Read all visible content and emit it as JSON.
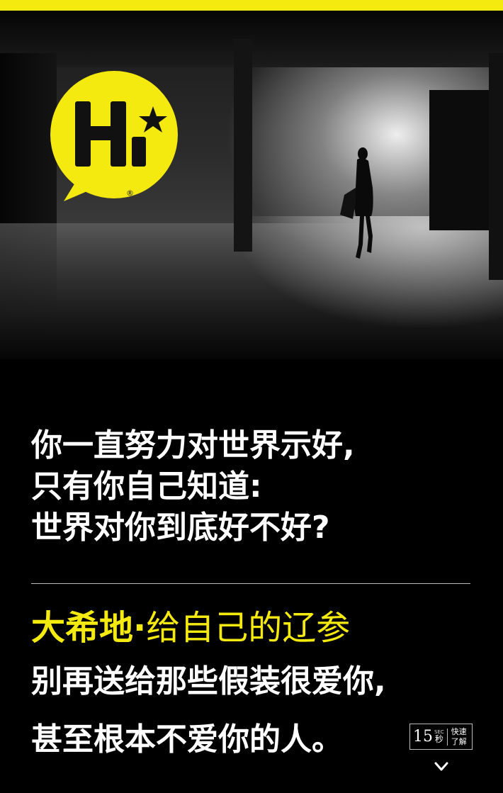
{
  "logo": {
    "text": "Hi",
    "mark": "®",
    "bubble_color": "#f5ea10"
  },
  "headline": {
    "line1": "你一直努力对世界示好,",
    "line2": "只有你自己知道:",
    "line3": "世界对你到底好不好?"
  },
  "brand": {
    "name": "大希地",
    "separator": "·",
    "tagline": "给自己的辽参"
  },
  "body": {
    "line1": "别再送给那些假装很爱你,",
    "line2": "甚至根本不爱你的人。"
  },
  "badge": {
    "number": "15",
    "sec": "SEC",
    "unit": "秒",
    "text1": "快速",
    "text2": "了解"
  },
  "icons": {
    "scroll": "chevron-down-icon"
  },
  "colors": {
    "accent": "#f5ea10",
    "background": "#000000",
    "text": "#ffffff"
  }
}
